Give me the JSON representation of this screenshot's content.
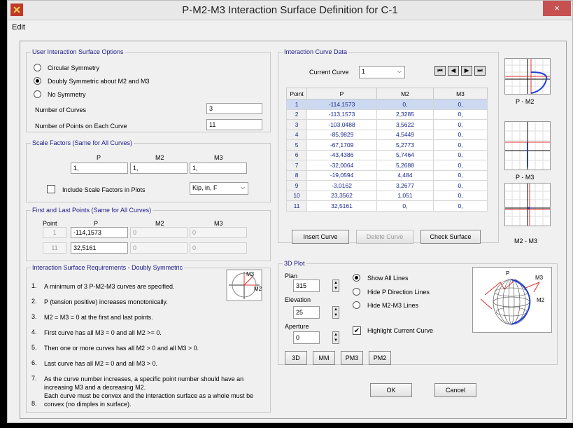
{
  "window": {
    "title": "P-M2-M3 Interaction Surface Definition for C-1",
    "close": "×"
  },
  "menu": {
    "edit": "Edit"
  },
  "options": {
    "legend": "User Interaction Surface Options",
    "sym": [
      "Circular Symmetry",
      "Doubly Symmetric about M2 and M3",
      "No Symmetry"
    ],
    "selected_sym": 1,
    "num_curves_label": "Number of Curves",
    "num_curves": "3",
    "num_points_label": "Number of Points on Each Curve",
    "num_points": "11"
  },
  "scale": {
    "legend": "Scale Factors (Same for All Curves)",
    "headers": [
      "P",
      "M2",
      "M3"
    ],
    "values": [
      "1,",
      "1,",
      "1,"
    ],
    "include_label": "Include Scale Factors in Plots",
    "units": "Kip, in, F"
  },
  "points": {
    "legend": "First and Last Points (Same for All Curves)",
    "headers": [
      "Point",
      "P",
      "M2",
      "M3"
    ],
    "rows": [
      [
        "1",
        "-114,1573",
        "0",
        "0"
      ],
      [
        "11",
        "32,5161",
        "0",
        "0"
      ]
    ]
  },
  "req": {
    "legend": "Interaction Surface Requirements - Doubly Symmetric",
    "nums": [
      "1.",
      "2.",
      "3.",
      "4.",
      "5.",
      "6.",
      "7.",
      "8."
    ],
    "items": [
      "A minimum of 3 P-M2-M3 curves are specified.",
      "P (tension positive) increases monotonically.",
      "M2 = M3 = 0 at the first and last points.",
      "First curve has all M3 = 0 and all M2 >= 0.",
      "Then one or more curves has all M2 > 0 and all M3 > 0.",
      "Last curve has all M2 = 0 and all M3 > 0.",
      "As the curve number increases, a specific point number should have an increasing M3 and a decreasing M2.",
      "Each curve must be convex and the interaction surface as a whole must be convex (no dimples in surface)."
    ],
    "axis_m3": "M3",
    "axis_m2": "M2"
  },
  "curve": {
    "legend": "Interaction Curve Data",
    "current_label": "Current Curve",
    "current_value": "1",
    "nav": [
      "⏮",
      "◀",
      "▶",
      "⏭"
    ],
    "headers": [
      "Point",
      "P",
      "M2",
      "M3"
    ],
    "rows": [
      [
        "1",
        "-114,1573",
        "0,",
        "0,"
      ],
      [
        "2",
        "-113,1573",
        "2,3285",
        "0,"
      ],
      [
        "3",
        "-103,0488",
        "3,5622",
        "0,"
      ],
      [
        "4",
        "-85,9829",
        "4,5449",
        "0,"
      ],
      [
        "5",
        "-67,1709",
        "5,2773",
        "0,"
      ],
      [
        "6",
        "-43,4386",
        "5,7464",
        "0,"
      ],
      [
        "7",
        "-32,0064",
        "5,2688",
        "0,"
      ],
      [
        "8",
        "-19,0594",
        "4,484",
        "0,"
      ],
      [
        "9",
        "-3,0162",
        "3,2677",
        "0,"
      ],
      [
        "10",
        "23,3562",
        "1,051",
        "0,"
      ],
      [
        "11",
        "32,5161",
        "0,",
        "0,"
      ]
    ],
    "insert": "Insert Curve",
    "delete": "Delete Curve",
    "check": "Check Surface"
  },
  "mini_plots": [
    "P - M2",
    "P - M3",
    "M2 - M3"
  ],
  "plot3d": {
    "legend": "3D Plot",
    "plan_label": "Plan",
    "plan": "315",
    "elev_label": "Elevation",
    "elev": "25",
    "aper_label": "Aperture",
    "aper": "0",
    "show_opts": [
      "Show All Lines",
      "Hide P Direction Lines",
      "Hide M2-M3 Lines"
    ],
    "highlight": "Highlight Current Curve",
    "view_buttons": [
      "3D",
      "MM",
      "PM3",
      "PM2"
    ],
    "label_p": "P",
    "label_m3": "M3",
    "label_m2": "M2"
  },
  "footer": {
    "ok": "OK",
    "cancel": "Cancel"
  },
  "colors": {
    "accent": "#1a1a8c",
    "curve": "#1f3fd6",
    "red": "#e03030"
  }
}
